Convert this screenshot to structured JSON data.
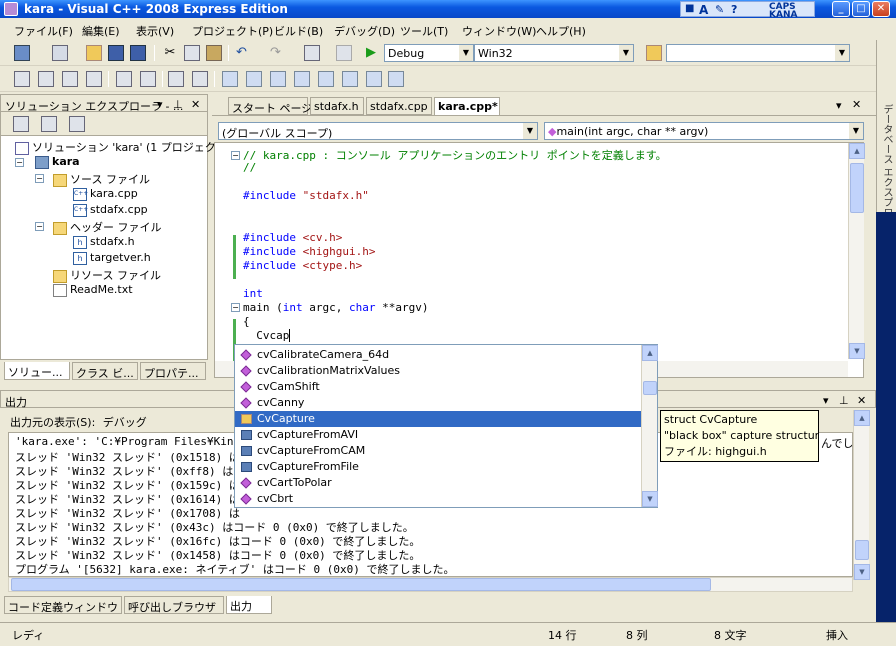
{
  "window": {
    "title": "kara - Visual C++ 2008 Express Edition"
  },
  "langbar": {
    "caps": "CAPS",
    "kana": "KANA"
  },
  "menu": [
    "ファイル(F)",
    "編集(E)",
    "表示(V)",
    "プロジェクト(P)",
    "ビルド(B)",
    "デバッグ(D)",
    "ツール(T)",
    "ウィンドウ(W)",
    "ヘルプ(H)"
  ],
  "toolbar": {
    "config": "Debug",
    "platform": "Win32"
  },
  "solution_explorer": {
    "title": "ソリューション エクスプローラ - ...",
    "pin": "ᵖ",
    "items": [
      {
        "label": "ソリューション 'kara' (1 プロジェクト)",
        "icon": "solution-icon"
      },
      {
        "label": "kara",
        "icon": "project-icon"
      },
      {
        "label": "ソース ファイル",
        "icon": "folder-icon"
      },
      {
        "label": "kara.cpp",
        "icon": "cpp-file-icon"
      },
      {
        "label": "stdafx.cpp",
        "icon": "cpp-file-icon"
      },
      {
        "label": "ヘッダー ファイル",
        "icon": "folder-icon"
      },
      {
        "label": "stdafx.h",
        "icon": "header-file-icon"
      },
      {
        "label": "targetver.h",
        "icon": "header-file-icon"
      },
      {
        "label": "リソース ファイル",
        "icon": "folder-icon"
      },
      {
        "label": "ReadMe.txt",
        "icon": "text-file-icon"
      }
    ],
    "tabs": [
      "ソリュー...",
      "クラス ビ...",
      "プロパテ..."
    ]
  },
  "editor": {
    "tabs": [
      "スタート ページ",
      "stdafx.h",
      "stdafx.cpp",
      "kara.cpp*"
    ],
    "scope_combo": "(グローバル スコープ)",
    "func_combo": "main(int argc, char ** argv)",
    "lines": [
      "// kara.cpp : コンソール アプリケーションのエントリ ポイントを定義します。",
      "//",
      "",
      "#include \"stdafx.h\"",
      "",
      "",
      "#include <cv.h>",
      "#include <highgui.h>",
      "#include <ctype.h>",
      "",
      "int",
      "main (int argc, char **argv)",
      "{",
      "  Cvcap"
    ]
  },
  "autocomplete": {
    "items": [
      "cvCalibrateCamera_64d",
      "cvCalibrationMatrixValues",
      "cvCamShift",
      "cvCanny",
      "CvCapture",
      "cvCaptureFromAVI",
      "cvCaptureFromCAM",
      "cvCaptureFromFile",
      "cvCartToPolar",
      "cvCbrt"
    ],
    "selected": "CvCapture",
    "tooltip": [
      "struct CvCapture",
      "\"black box\" capture structure",
      "ファイル: highgui.h"
    ]
  },
  "output": {
    "title": "出力",
    "source_label": "出力元の表示(S):",
    "source_value": "デバッグ",
    "lines": [
      "'kara.exe': 'C:¥Program Files¥Kingsoft",
      "スレッド 'Win32 スレッド' (0x1518) は",
      "スレッド 'Win32 スレッド' (0xff8) は",
      "スレッド 'Win32 スレッド' (0x159c) は",
      "スレッド 'Win32 スレッド' (0x1614) は",
      "スレッド 'Win32 スレッド' (0x1708) は",
      "スレッド 'Win32 スレッド' (0x43c) はコード 0 (0x0) で終了しました。",
      "スレッド 'Win32 スレッド' (0x16fc) はコード 0 (0x0) で終了しました。",
      "スレッド 'Win32 スレッド' (0x1458) はコード 0 (0x0) で終了しました。",
      "プログラム '[5632] kara.exe: ネイティブ' はコード 0 (0x0) で終了しました。"
    ],
    "tail_text": "んでし",
    "tabs": [
      "コード定義ウィンドウ",
      "呼び出しブラウザ",
      "出力"
    ]
  },
  "right_strip": "データベース エクスプローラ",
  "status": {
    "ready": "レディ",
    "line": "14 行",
    "col": "8 列",
    "char": "8 文字",
    "mode": "挿入"
  }
}
